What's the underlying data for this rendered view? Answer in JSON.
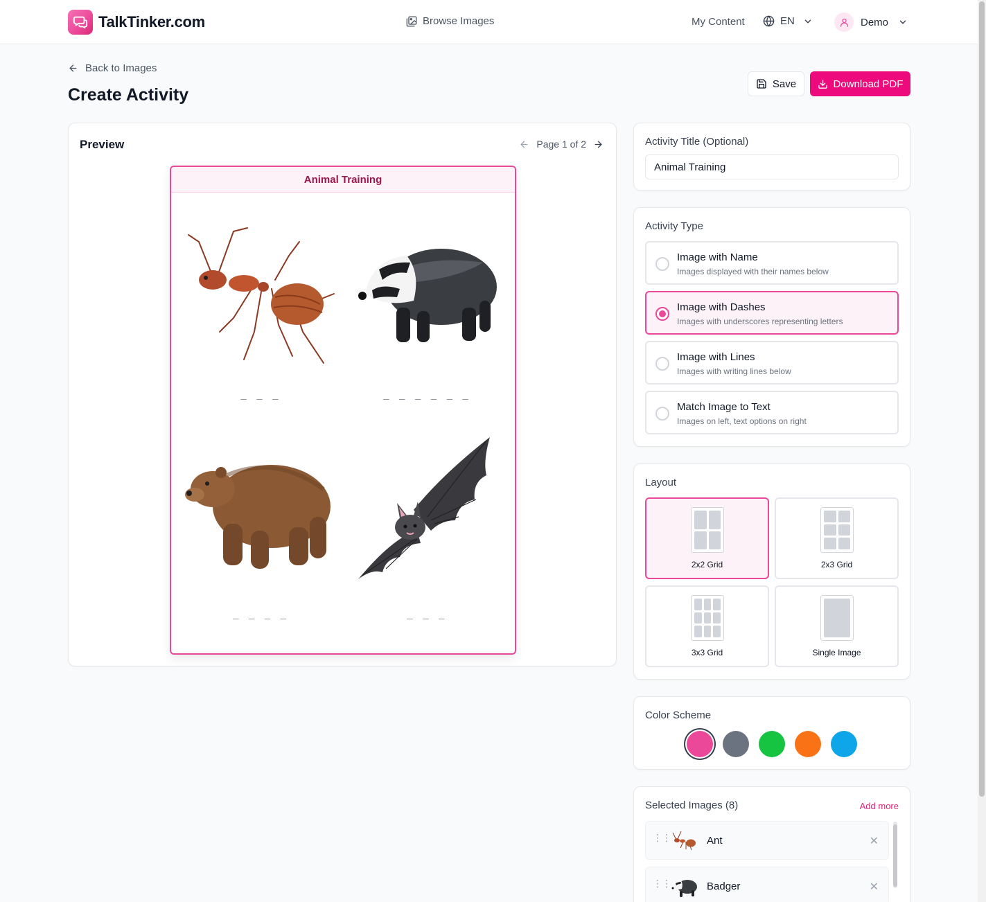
{
  "header": {
    "brand": "TalkTinker.com",
    "browse_label": "Browse Images",
    "my_content_label": "My Content",
    "language": "EN",
    "user_name": "Demo"
  },
  "page": {
    "back_label": "Back to Images",
    "title": "Create Activity",
    "save_label": "Save",
    "download_label": "Download PDF"
  },
  "preview": {
    "label": "Preview",
    "page_indicator": "Page 1 of 2",
    "sheet_title": "Animal Training",
    "cells": [
      {
        "animal": "ant",
        "dashes": "_ _ _"
      },
      {
        "animal": "badger",
        "dashes": "_ _ _ _ _ _"
      },
      {
        "animal": "bear",
        "dashes": "_ _ _ _"
      },
      {
        "animal": "bat",
        "dashes": "_ _ _"
      }
    ]
  },
  "settings": {
    "title_label": "Activity Title (Optional)",
    "title_value": "Animal Training",
    "type_label": "Activity Type",
    "types": [
      {
        "name": "Image with Name",
        "desc": "Images displayed with their names below",
        "selected": false
      },
      {
        "name": "Image with Dashes",
        "desc": "Images with underscores representing letters",
        "selected": true
      },
      {
        "name": "Image with Lines",
        "desc": "Images with writing lines below",
        "selected": false
      },
      {
        "name": "Match Image to Text",
        "desc": "Images on left, text options on right",
        "selected": false
      }
    ],
    "layout_label": "Layout",
    "layouts": [
      {
        "name": "2x2 Grid",
        "selected": true
      },
      {
        "name": "2x3 Grid",
        "selected": false
      },
      {
        "name": "3x3 Grid",
        "selected": false
      },
      {
        "name": "Single Image",
        "selected": false
      }
    ],
    "color_label": "Color Scheme",
    "colors": [
      "#ec4899",
      "#6b7280",
      "#16c442",
      "#f97316",
      "#0ea5e9"
    ],
    "selected_color": "#ec4899",
    "images_label": "Selected Images (8)",
    "add_more_label": "Add more",
    "images": [
      {
        "name": "Ant"
      },
      {
        "name": "Badger"
      }
    ]
  }
}
